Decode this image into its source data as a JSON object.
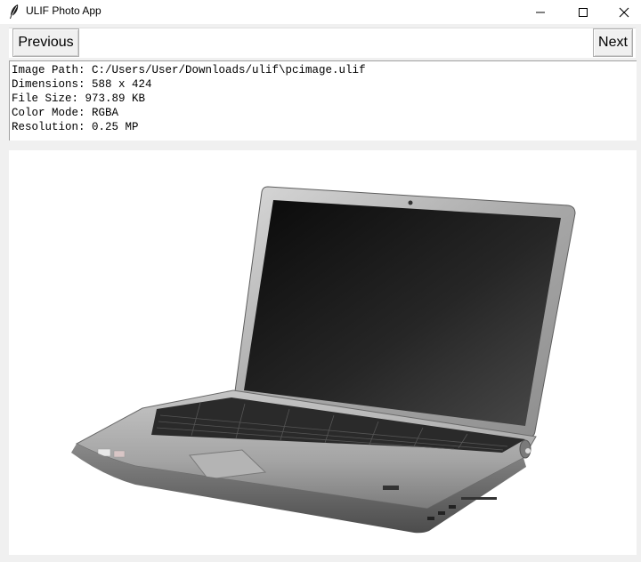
{
  "window": {
    "title": "ULIF Photo App",
    "icon": "feather-icon",
    "controls": [
      "minimize-icon",
      "maximize-icon",
      "close-icon"
    ]
  },
  "nav": {
    "previous_label": "Previous",
    "next_label": "Next"
  },
  "info": {
    "image_path": "Image Path: C:/Users/User/Downloads/ulif\\pcimage.ulif",
    "dimensions": "Dimensions: 588 x 424",
    "file_size": "File Size: 973.89 KB",
    "color_mode": "Color Mode: RGBA",
    "resolution": "Resolution: 0.25 MP"
  },
  "image": {
    "subject": "laptop"
  }
}
